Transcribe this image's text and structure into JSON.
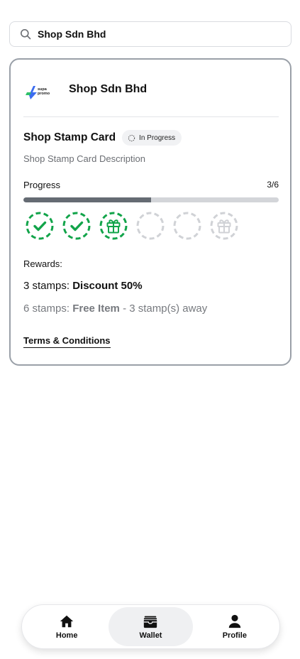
{
  "search": {
    "value": "Shop Sdn Bhd",
    "icon": "search-icon"
  },
  "card": {
    "merchant": {
      "name": "Shop Sdn Bhd",
      "logo_text_top": "supa",
      "logo_text_bottom": "promo"
    },
    "title": "Shop Stamp Card",
    "status": "In Progress",
    "description": "Shop Stamp Card Description",
    "progress": {
      "label": "Progress",
      "count": "3/6",
      "collected": 3,
      "total": 6,
      "fraction": 0.5
    },
    "stamps": [
      {
        "state": "collected",
        "icon": "check-icon"
      },
      {
        "state": "collected",
        "icon": "check-icon"
      },
      {
        "state": "collected",
        "icon": "gift-icon"
      },
      {
        "state": "empty",
        "icon": ""
      },
      {
        "state": "empty",
        "icon": ""
      },
      {
        "state": "empty",
        "icon": "gift-icon"
      }
    ],
    "rewards_label": "Rewards:",
    "rewards": [
      {
        "stamps": "3 stamps:",
        "name": "Discount 50%",
        "note": ""
      },
      {
        "stamps": "6 stamps:",
        "name": "Free Item",
        "note": "- 3 stamp(s) away"
      }
    ],
    "terms_label": "Terms & Conditions"
  },
  "nav": {
    "items": [
      {
        "label": "Home",
        "icon": "home-icon"
      },
      {
        "label": "Wallet",
        "icon": "wallet-icon",
        "active": true
      },
      {
        "label": "Profile",
        "icon": "profile-icon"
      }
    ]
  },
  "colors": {
    "stamp_collected": "#12a44a",
    "stamp_empty": "#d0d2d6",
    "progress_fill": "#656b73",
    "progress_track": "#d3d5d9",
    "card_border": "#9aa0a8"
  }
}
